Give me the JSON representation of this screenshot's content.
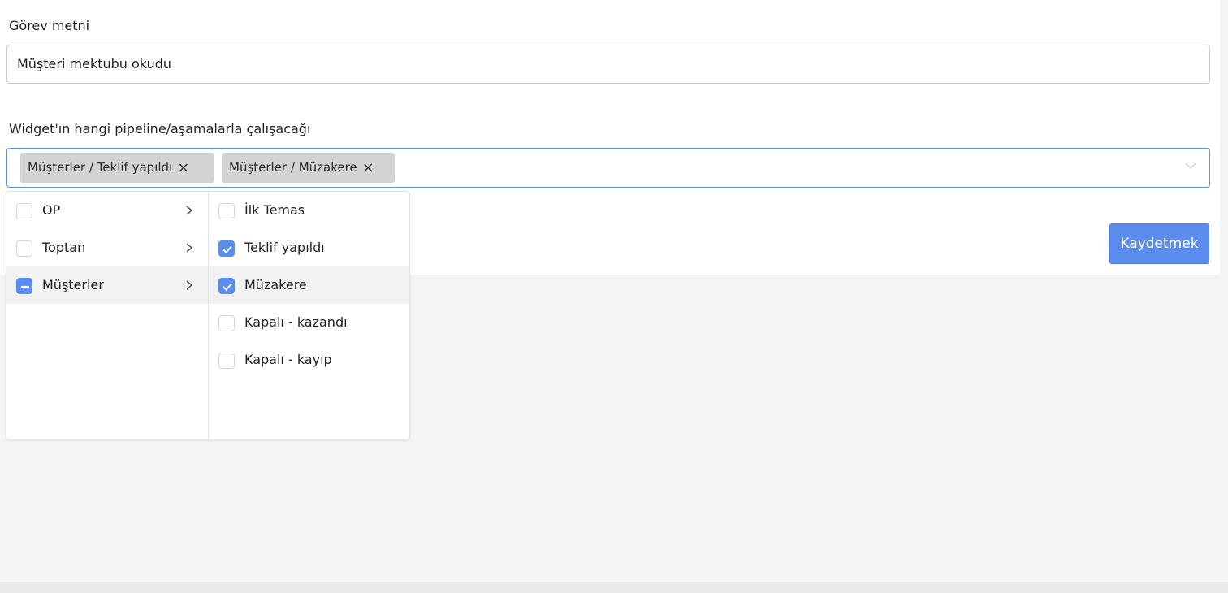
{
  "form": {
    "task_label": "Görev metni",
    "task_value": "Müşteri mektubu okudu",
    "pipeline_label": "Widget'ın hangi pipeline/aşamalarla çalışacağı",
    "selected_tags": [
      {
        "label": "Müşterler / Teklif yapıldı"
      },
      {
        "label": "Müşterler / Müzakere"
      }
    ],
    "save_label": "Kaydetmek"
  },
  "dropdown": {
    "pipelines": [
      {
        "label": "OP",
        "state": "unchecked"
      },
      {
        "label": "Toptan",
        "state": "unchecked"
      },
      {
        "label": "Müşterler",
        "state": "partial",
        "active": true
      }
    ],
    "stages": [
      {
        "label": "İlk Temas",
        "checked": false
      },
      {
        "label": "Teklif yapıldı",
        "checked": true
      },
      {
        "label": "Müzakere",
        "checked": true,
        "active": true
      },
      {
        "label": "Kapalı - kazandı",
        "checked": false
      },
      {
        "label": "Kapalı - kayıp",
        "checked": false
      }
    ]
  },
  "colors": {
    "accent": "#5b8def",
    "tag_bg": "#d3d3d3",
    "page_bg": "#f4f4f4"
  }
}
